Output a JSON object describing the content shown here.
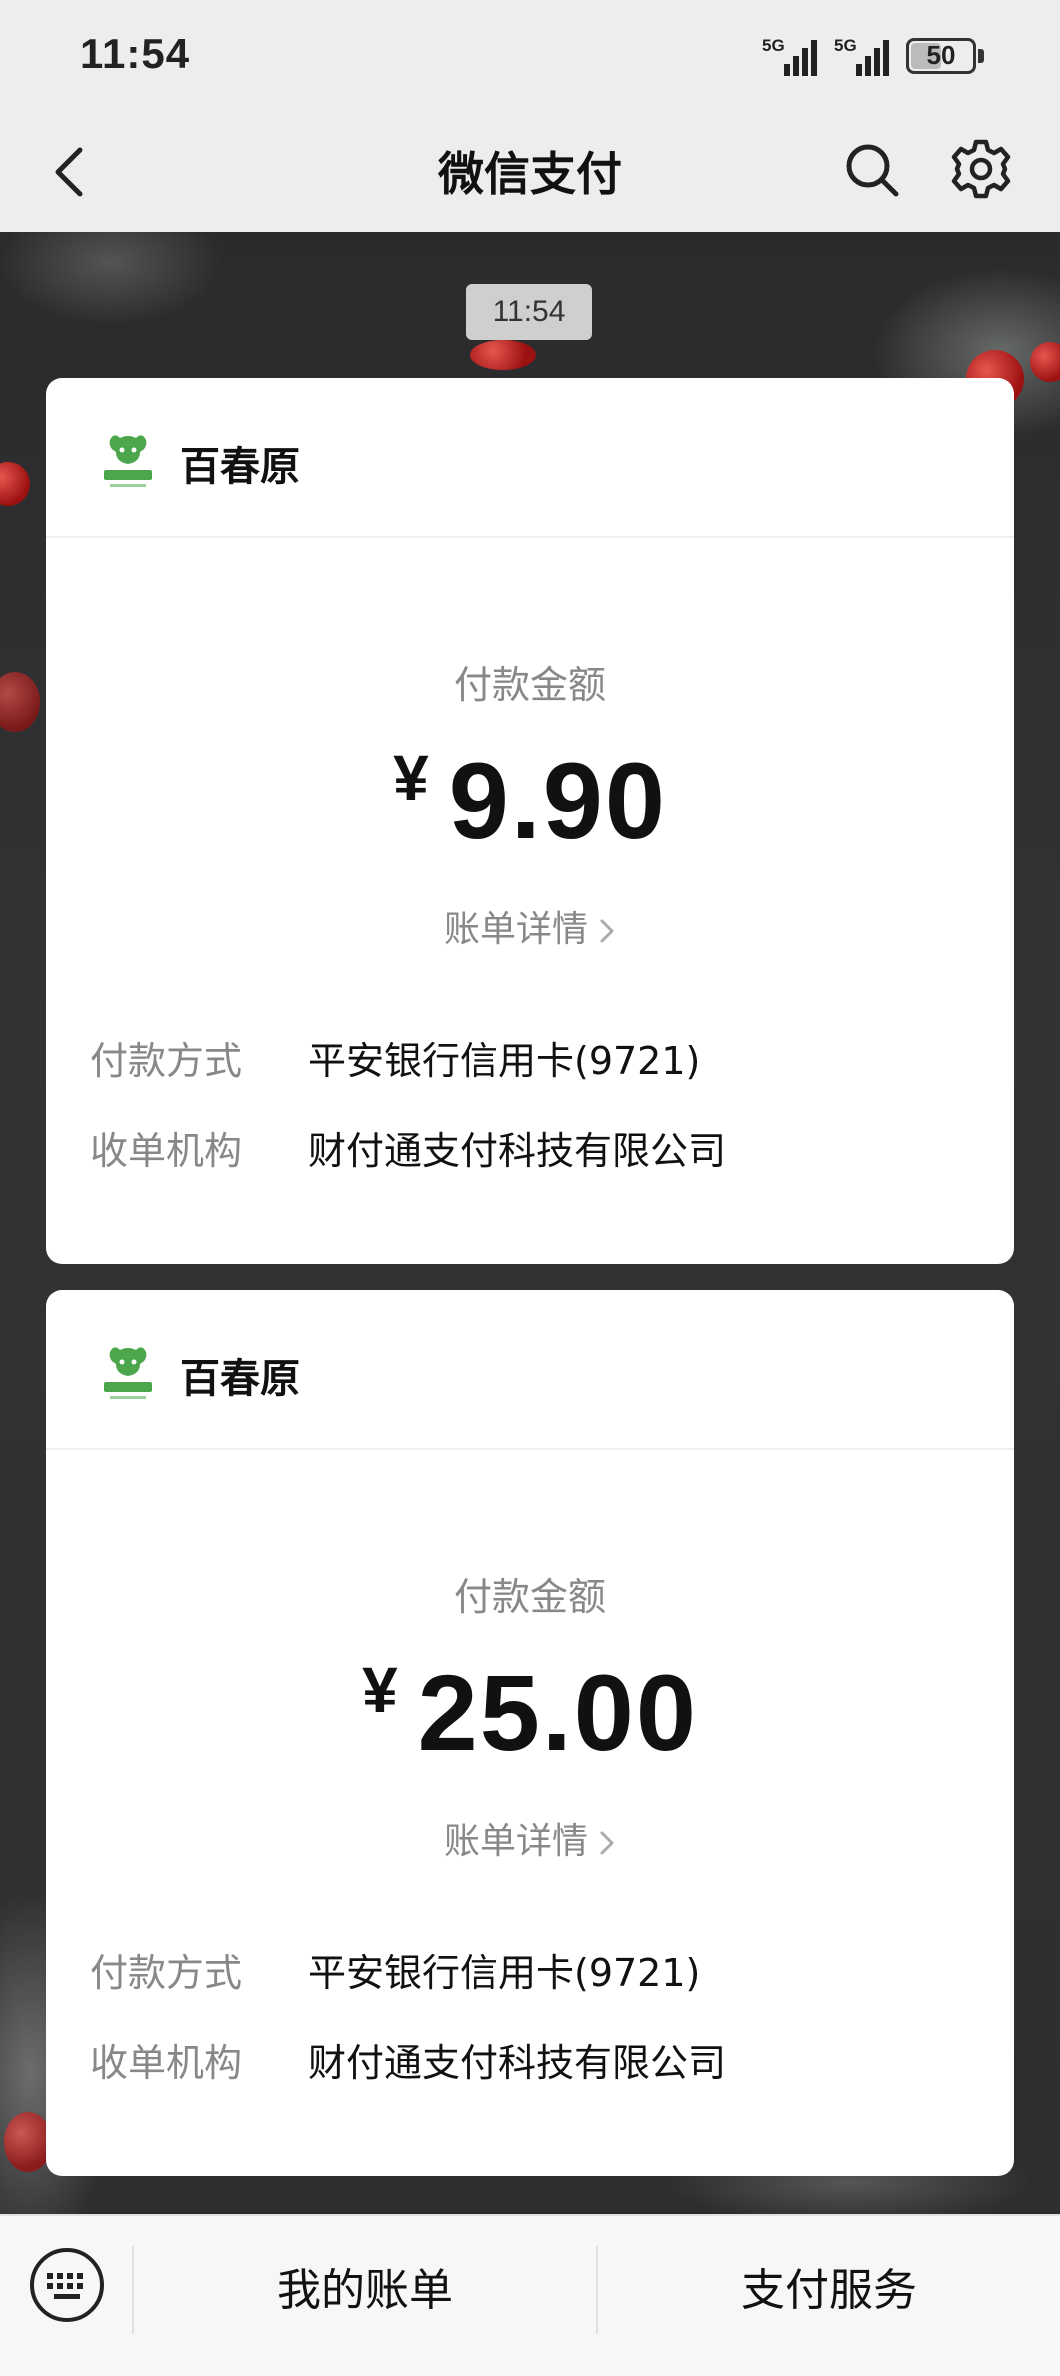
{
  "status_bar": {
    "time": "11:54",
    "signal1_label": "5G",
    "signal2_label": "5G",
    "battery": "50",
    "battery_level": 0.5
  },
  "nav": {
    "title": "微信支付",
    "back_icon": "chevron-left-icon",
    "search_icon": "search-icon",
    "settings_icon": "gear-icon"
  },
  "chat": {
    "timestamp": "11:54",
    "messages": [
      {
        "merchant": "百春原",
        "amount_label": "付款金额",
        "currency": "¥",
        "amount": "9.90",
        "bill_detail": "账单详情",
        "payment_method_label": "付款方式",
        "payment_method": "平安银行信用卡(9721)",
        "acquirer_label": "收单机构",
        "acquirer": "财付通支付科技有限公司"
      },
      {
        "merchant": "百春原",
        "amount_label": "付款金额",
        "currency": "¥",
        "amount": "25.00",
        "bill_detail": "账单详情",
        "payment_method_label": "付款方式",
        "payment_method": "平安银行信用卡(9721)",
        "acquirer_label": "收单机构",
        "acquirer": "财付通支付科技有限公司"
      }
    ]
  },
  "bottom_bar": {
    "keyboard_icon": "keyboard-icon",
    "my_bills": "我的账单",
    "payment_services": "支付服务"
  },
  "colors": {
    "accent_green": "#4ca64c",
    "muted_text": "#888888",
    "background": "#ededed"
  }
}
